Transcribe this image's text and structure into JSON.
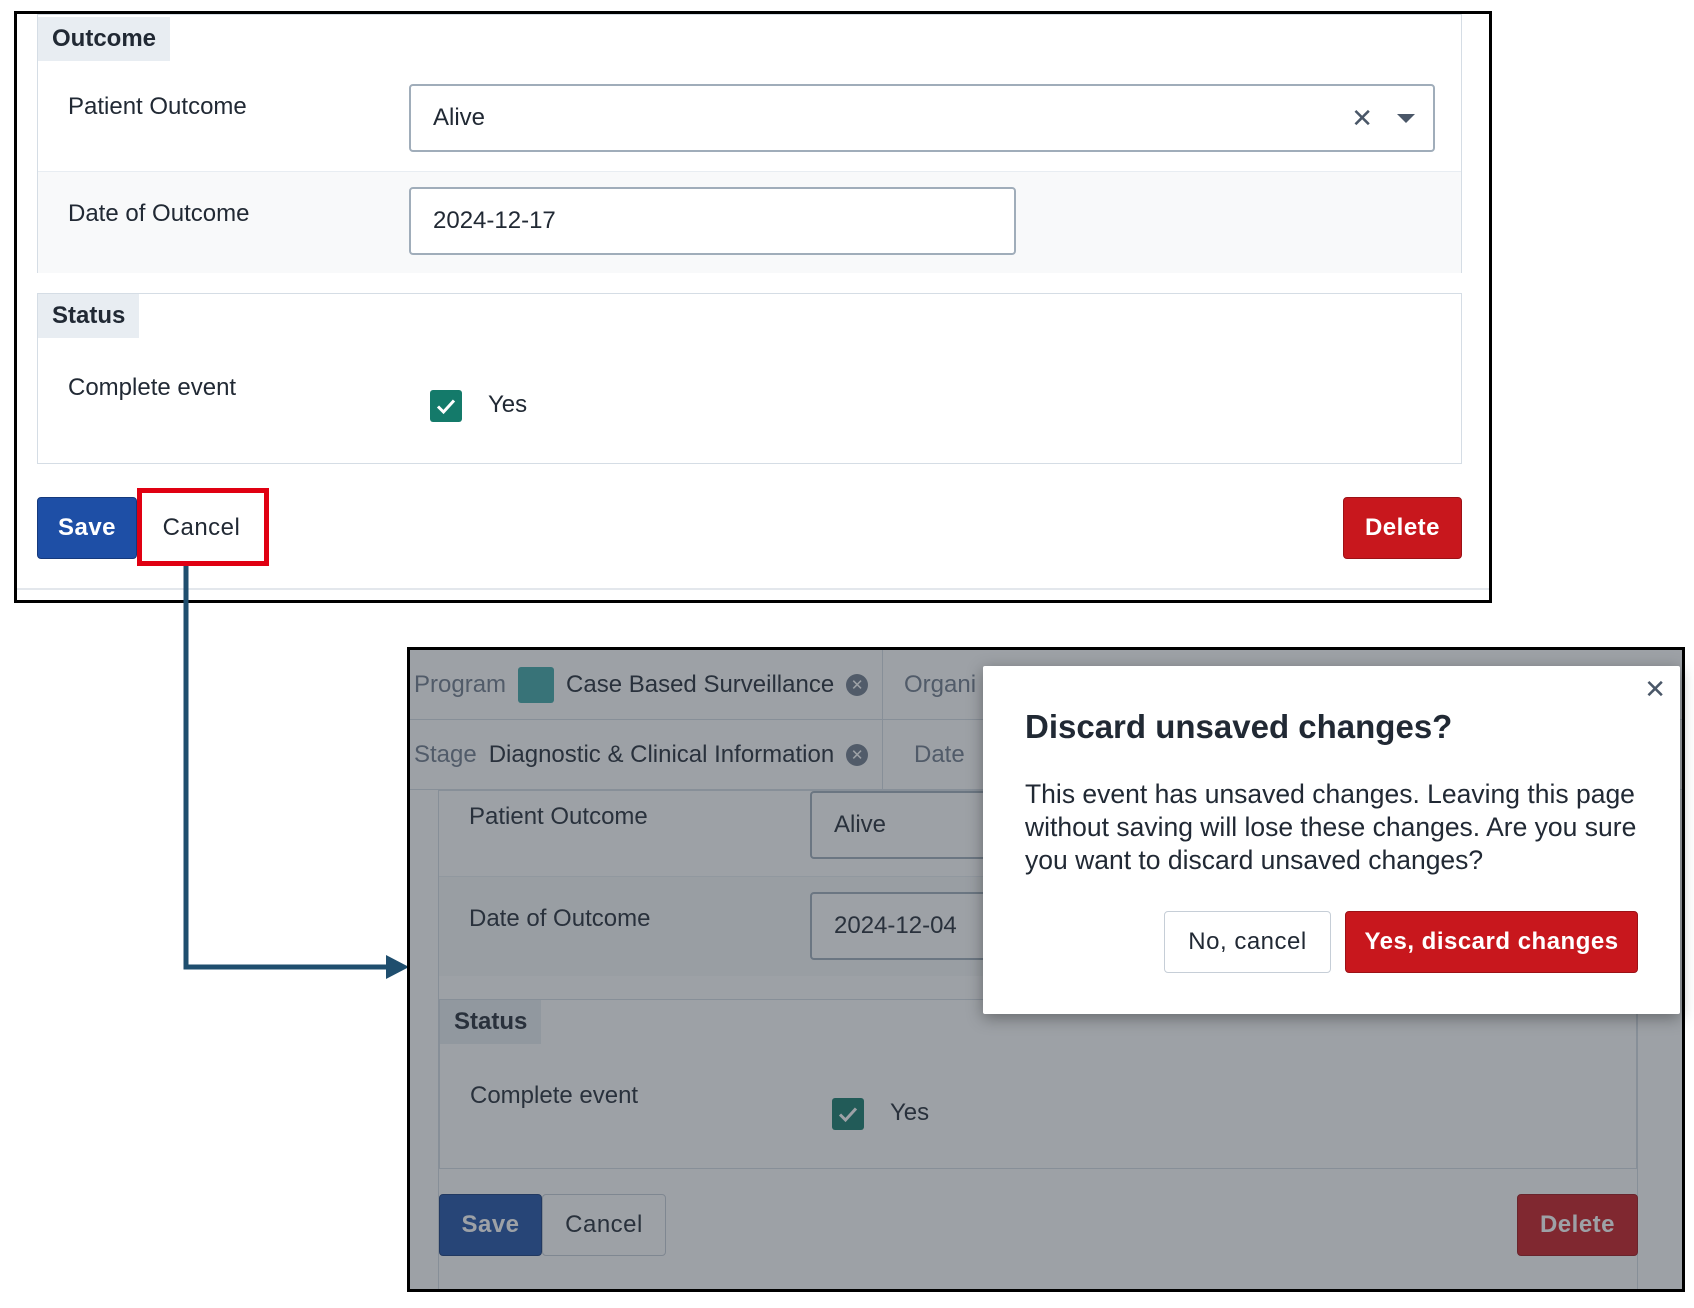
{
  "top": {
    "outcome_section": {
      "title": "Outcome",
      "patient_outcome": {
        "label": "Patient Outcome",
        "value": "Alive"
      },
      "date_of_outcome": {
        "label": "Date of Outcome",
        "value": "2024-12-17"
      }
    },
    "status_section": {
      "title": "Status",
      "complete_event": {
        "label": "Complete event",
        "checkbox_label": "Yes",
        "checked": true
      }
    },
    "buttons": {
      "save": "Save",
      "cancel": "Cancel",
      "delete": "Delete"
    }
  },
  "bottom": {
    "filters": [
      {
        "key": "Program",
        "value": "Case Based Surveillance",
        "swatch_color": "#3fa7a7"
      },
      {
        "key": "Organi",
        "value": ""
      },
      {
        "key": "Stage",
        "value": "Diagnostic & Clinical Information"
      },
      {
        "key": "Date",
        "value": ""
      }
    ],
    "form": {
      "patient_outcome": {
        "label": "Patient Outcome",
        "value": "Alive"
      },
      "date_of_outcome": {
        "label": "Date of Outcome",
        "value": "2024-12-04"
      },
      "status_title": "Status",
      "complete_event": {
        "label": "Complete event",
        "checkbox_label": "Yes",
        "checked": true
      }
    },
    "buttons": {
      "save": "Save",
      "cancel": "Cancel",
      "delete": "Delete"
    }
  },
  "modal": {
    "close_icon": "close-icon",
    "title": "Discard unsaved changes?",
    "body": "This event has unsaved changes. Leaving this page without saving will lose these changes. Are you sure you want to discard unsaved changes?",
    "cancel_label": "No, cancel",
    "confirm_label": "Yes, discard changes"
  },
  "colors": {
    "primary": "#1e4fa6",
    "danger": "#c8171d",
    "checkbox": "#147a6a",
    "highlight": "#e00012",
    "connector": "#1f4e6e"
  }
}
